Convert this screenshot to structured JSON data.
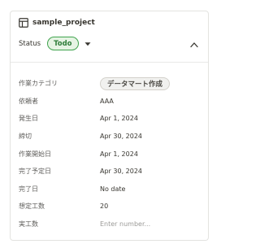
{
  "card": {
    "title": "sample_project",
    "status_label": "Status",
    "status_value": "Todo",
    "colors": {
      "status_border": "#3fa34d",
      "status_bg": "#e6f4e4",
      "status_text": "#2f7d3a"
    }
  },
  "properties": [
    {
      "label": "作業カテゴリ",
      "value": "データマート作成",
      "kind": "badge"
    },
    {
      "label": "依頼者",
      "value": "AAA"
    },
    {
      "label": "発生日",
      "value": "Apr 1, 2024"
    },
    {
      "label": "締切",
      "value": "Apr 30, 2024"
    },
    {
      "label": "作業開始日",
      "value": "Apr 1, 2024"
    },
    {
      "label": "完了予定日",
      "value": "Apr 30, 2024"
    },
    {
      "label": "完了日",
      "value": "No date"
    },
    {
      "label": "想定工数",
      "value": "20"
    },
    {
      "label": "実工数",
      "placeholder": "Enter number..."
    }
  ],
  "icons": {
    "title": "table-icon",
    "status_dropdown": "caret-down-icon",
    "collapse": "chevron-up-icon"
  }
}
